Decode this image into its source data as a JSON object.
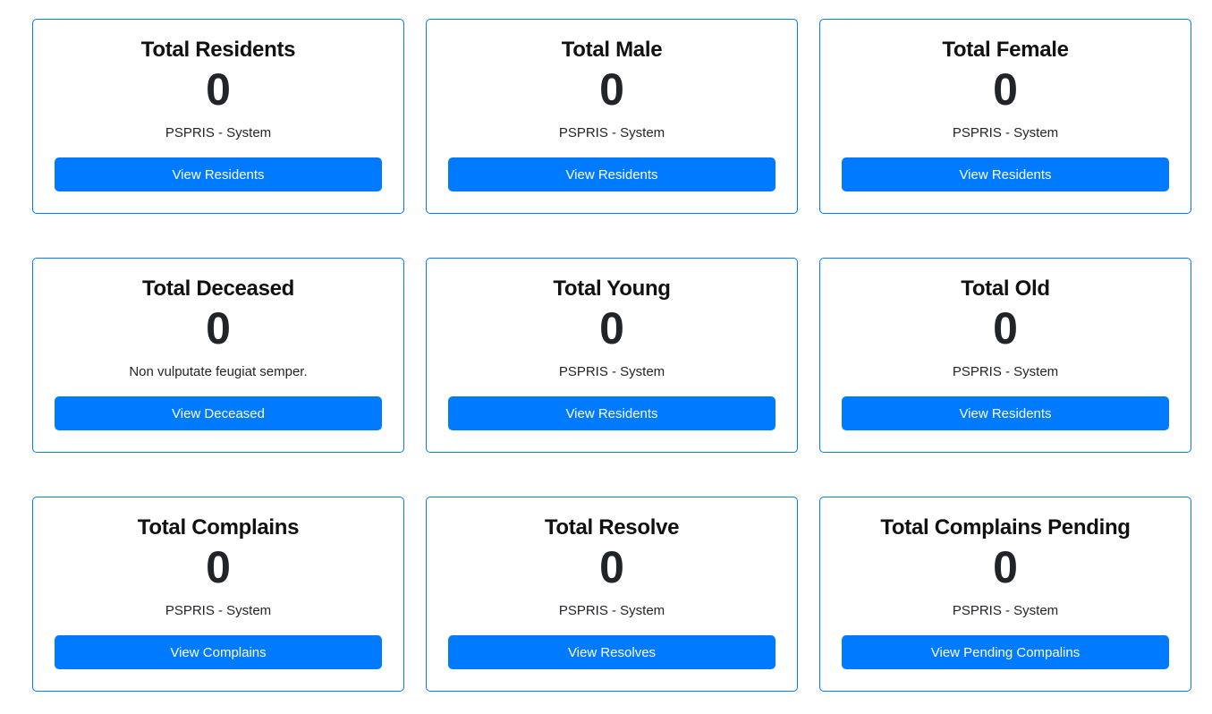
{
  "accent_color": "#007bff",
  "cards": [
    {
      "title": "Total Residents",
      "count": "0",
      "subtitle": "PSPRIS - System",
      "button": "View Residents"
    },
    {
      "title": "Total Male",
      "count": "0",
      "subtitle": "PSPRIS - System",
      "button": "View Residents"
    },
    {
      "title": "Total Female",
      "count": "0",
      "subtitle": "PSPRIS - System",
      "button": "View Residents"
    },
    {
      "title": "Total Deceased",
      "count": "0",
      "subtitle": "Non vulputate feugiat semper.",
      "button": "View Deceased"
    },
    {
      "title": "Total Young",
      "count": "0",
      "subtitle": "PSPRIS - System",
      "button": "View Residents"
    },
    {
      "title": "Total Old",
      "count": "0",
      "subtitle": "PSPRIS - System",
      "button": "View Residents"
    },
    {
      "title": "Total Complains",
      "count": "0",
      "subtitle": "PSPRIS - System",
      "button": "View Complains"
    },
    {
      "title": "Total Resolve",
      "count": "0",
      "subtitle": "PSPRIS - System",
      "button": "View Resolves"
    },
    {
      "title": "Total Complains Pending",
      "count": "0",
      "subtitle": "PSPRIS - System",
      "button": "View Pending Compalins"
    }
  ]
}
